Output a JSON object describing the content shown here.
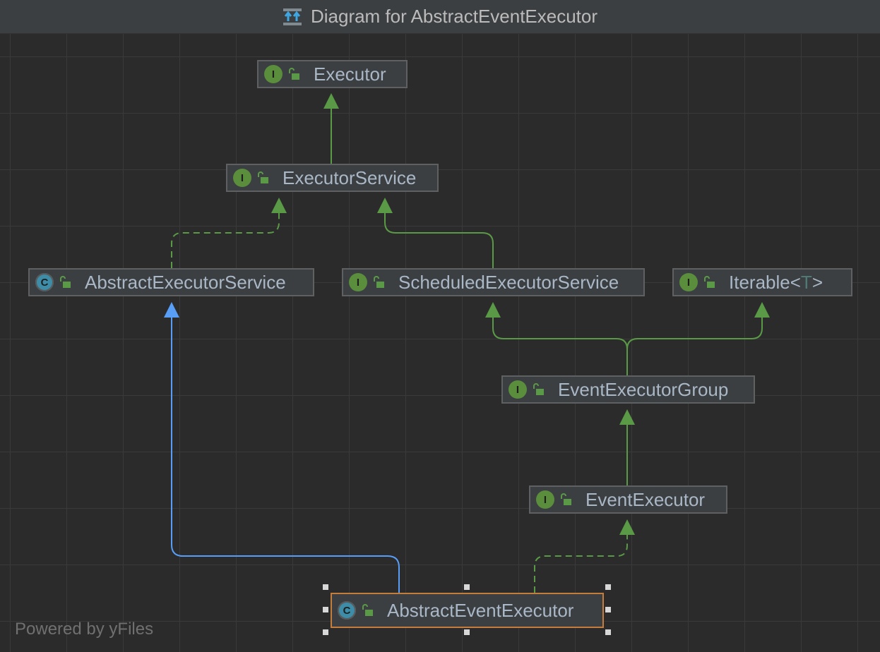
{
  "window": {
    "title": "Diagram for AbstractEventExecutor"
  },
  "nodes": {
    "executor": {
      "kind": "I",
      "name": "Executor"
    },
    "executor_service": {
      "kind": "I",
      "name": "ExecutorService"
    },
    "abstract_executor_service": {
      "kind": "C",
      "name": "AbstractExecutorService"
    },
    "scheduled_executor_service": {
      "kind": "I",
      "name": "ScheduledExecutorService"
    },
    "iterable": {
      "kind": "I",
      "name": "Iterable",
      "lt": "<",
      "type_param": "T",
      "gt": ">"
    },
    "event_executor_group": {
      "kind": "I",
      "name": "EventExecutorGroup"
    },
    "event_executor": {
      "kind": "I",
      "name": "EventExecutor"
    },
    "abstract_event_executor": {
      "kind": "C",
      "name": "AbstractEventExecutor"
    }
  },
  "edges": [
    {
      "from": "ExecutorService",
      "to": "Executor",
      "style": "solid-green"
    },
    {
      "from": "AbstractExecutorService",
      "to": "ExecutorService",
      "style": "dashed-green"
    },
    {
      "from": "ScheduledExecutorService",
      "to": "ExecutorService",
      "style": "solid-green"
    },
    {
      "from": "EventExecutorGroup",
      "to": "ScheduledExecutorService",
      "style": "solid-green"
    },
    {
      "from": "EventExecutorGroup",
      "to": "Iterable",
      "style": "solid-green"
    },
    {
      "from": "EventExecutor",
      "to": "EventExecutorGroup",
      "style": "solid-green"
    },
    {
      "from": "AbstractEventExecutor",
      "to": "EventExecutor",
      "style": "dashed-green"
    },
    {
      "from": "AbstractEventExecutor",
      "to": "AbstractExecutorService",
      "style": "solid-blue"
    }
  ],
  "colors": {
    "interface": "#5a8d3c",
    "class": "#3d8da8",
    "implements_edge": "#5a9a46",
    "extends_edge": "#589df6",
    "selection": "#c47d3a"
  },
  "footer": {
    "powered_by": "Powered by yFiles"
  }
}
